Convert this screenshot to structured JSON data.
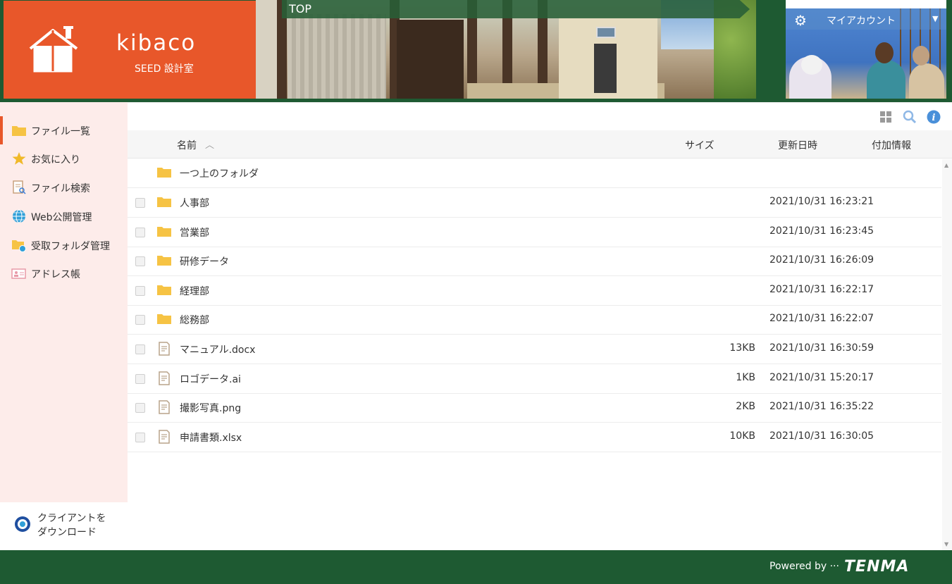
{
  "header": {
    "brand": "kibaco",
    "brand_sub": "SEED 設計室",
    "breadcrumb": "TOP",
    "account_label": "マイアカウント"
  },
  "sidebar": {
    "items": [
      {
        "label": "ファイル一覧",
        "icon": "folder-icon",
        "active": true
      },
      {
        "label": "お気に入り",
        "icon": "star-icon",
        "active": false
      },
      {
        "label": "ファイル検索",
        "icon": "file-search-icon",
        "active": false
      },
      {
        "label": "Web公開管理",
        "icon": "globe-icon",
        "active": false
      },
      {
        "label": "受取フォルダ管理",
        "icon": "folder-globe-icon",
        "active": false
      },
      {
        "label": "アドレス帳",
        "icon": "address-card-icon",
        "active": false
      }
    ],
    "download_line1": "クライアントを",
    "download_line2": "ダウンロード"
  },
  "table": {
    "columns": {
      "name": "名前",
      "size": "サイズ",
      "updated": "更新日時",
      "extra": "付加情報"
    },
    "parent": "一つ上のフォルダ",
    "rows": [
      {
        "name": "人事部",
        "type": "folder",
        "size": "",
        "date": "2021/10/31 16:23:21"
      },
      {
        "name": "営業部",
        "type": "folder",
        "size": "",
        "date": "2021/10/31 16:23:45"
      },
      {
        "name": "研修データ",
        "type": "folder",
        "size": "",
        "date": "2021/10/31 16:26:09"
      },
      {
        "name": "経理部",
        "type": "folder",
        "size": "",
        "date": "2021/10/31 16:22:17"
      },
      {
        "name": "総務部",
        "type": "folder",
        "size": "",
        "date": "2021/10/31 16:22:07"
      },
      {
        "name": "マニュアル.docx",
        "type": "file",
        "size": "13KB",
        "date": "2021/10/31 16:30:59"
      },
      {
        "name": "ロゴデータ.ai",
        "type": "file",
        "size": "1KB",
        "date": "2021/10/31 15:20:17"
      },
      {
        "name": "撮影写真.png",
        "type": "file",
        "size": "2KB",
        "date": "2021/10/31 16:35:22"
      },
      {
        "name": "申請書類.xlsx",
        "type": "file",
        "size": "10KB",
        "date": "2021/10/31 16:30:05"
      }
    ]
  },
  "footer": {
    "powered": "Powered by ···",
    "brand": "TENMA"
  },
  "colors": {
    "brand_orange": "#e8572a",
    "header_green": "#1e5a32",
    "sidebar_bg": "#fdecea",
    "folder_yellow": "#f6c344",
    "info_blue": "#4a90d9"
  }
}
